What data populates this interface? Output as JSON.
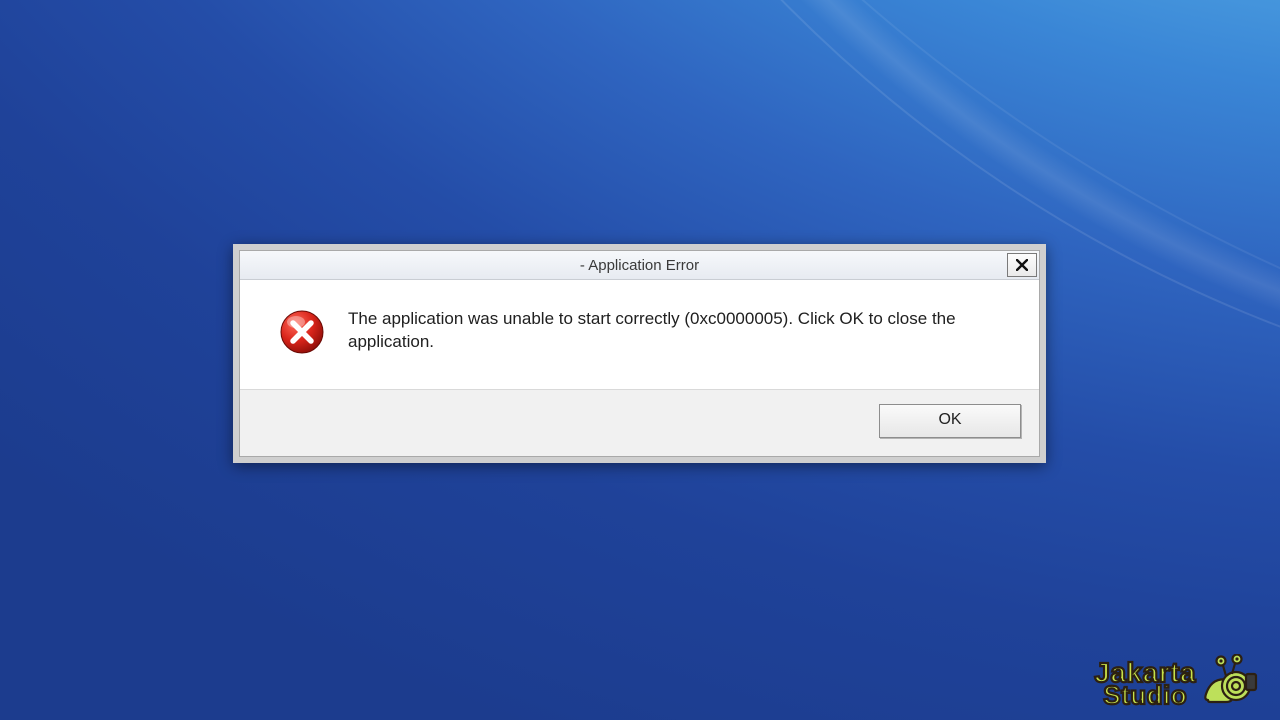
{
  "dialog": {
    "title": "- Application Error",
    "message": "The application was unable to start correctly (0xc0000005). Click OK to close the application.",
    "close_label": "Close",
    "ok_label": "OK"
  },
  "watermark": {
    "line1": "Jakarta",
    "line2": "Studio"
  }
}
